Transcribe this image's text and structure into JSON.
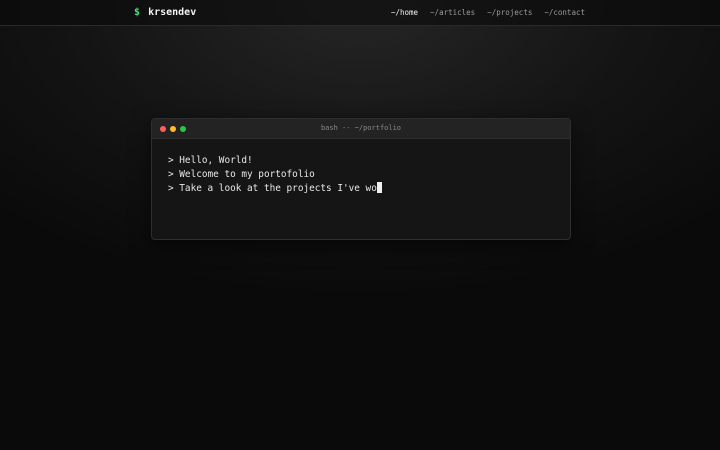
{
  "navbar": {
    "brand_symbol": "$",
    "brand_name": "krsendev",
    "links": [
      {
        "label": "~/home",
        "active": true
      },
      {
        "label": "~/articles",
        "active": false
      },
      {
        "label": "~/projects",
        "active": false
      },
      {
        "label": "~/contact",
        "active": false
      }
    ]
  },
  "terminal": {
    "title": "bash -- ~/portfolio",
    "lines": [
      "> Hello, World!",
      "> Welcome to my portofolio",
      "> Take a look at the projects I've wo"
    ]
  },
  "colors": {
    "accent": "#4ade80",
    "dot_red": "#ff5f57",
    "dot_yellow": "#febc2e",
    "dot_green": "#28c840"
  }
}
